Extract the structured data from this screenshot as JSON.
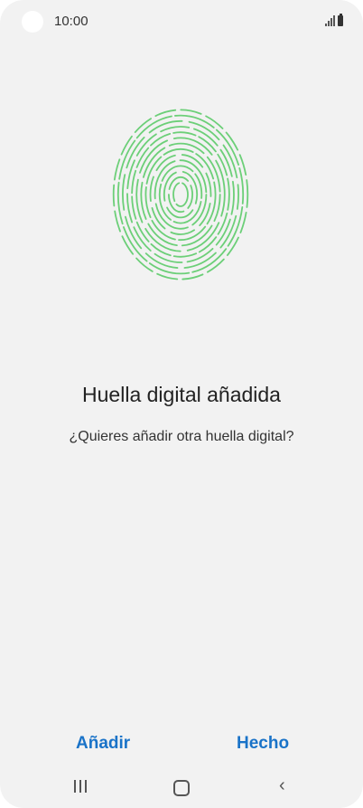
{
  "status_bar": {
    "time": "10:00"
  },
  "colors": {
    "background": "#f2f2f2",
    "fingerprint": "#6ccf78",
    "accent": "#1a73c8"
  },
  "main": {
    "icon": "fingerprint-icon",
    "title": "Huella digital añadida",
    "subtitle": "¿Quieres añadir otra huella digital?"
  },
  "actions": {
    "add_label": "Añadir",
    "done_label": "Hecho"
  },
  "navbar": {
    "recents_icon": "recents-icon",
    "home_icon": "home-icon",
    "back_icon": "back-icon"
  }
}
